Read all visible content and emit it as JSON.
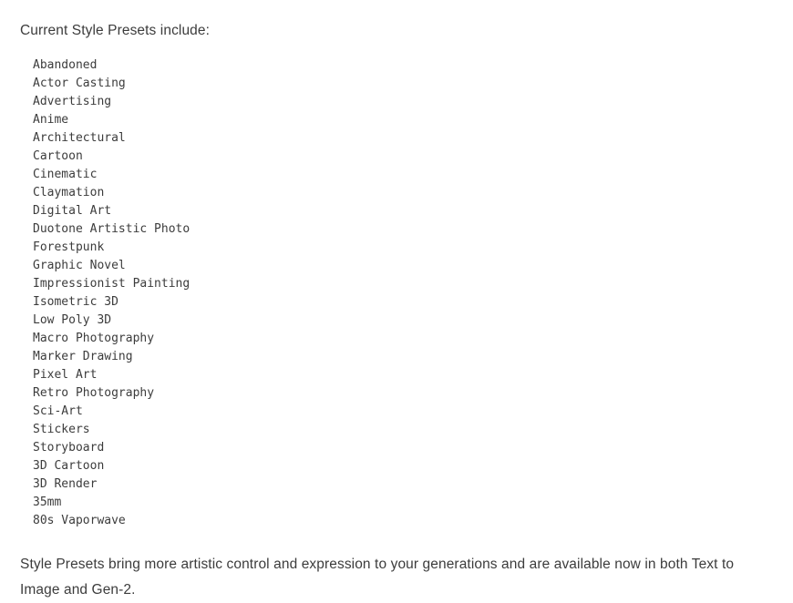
{
  "article": {
    "intro_text": "Current Style Presets include:",
    "presets": [
      "Abandoned",
      "Actor Casting",
      "Advertising",
      "Anime",
      "Architectural",
      "Cartoon",
      "Cinematic",
      "Claymation",
      "Digital Art",
      "Duotone Artistic Photo",
      "Forestpunk",
      "Graphic Novel",
      "Impressionist Painting",
      "Isometric 3D",
      "Low Poly 3D",
      "Macro Photography",
      "Marker Drawing",
      "Pixel Art",
      "Retro Photography",
      "Sci-Art",
      "Stickers",
      "Storyboard",
      "3D Cartoon",
      "3D Render",
      "35mm",
      "80s Vaporwave"
    ],
    "outro_text": "Style Presets bring more artistic control and expression to your generations and are available now in both Text to Image and Gen-2."
  },
  "colors": {
    "text": "#3c3c3c",
    "background": "#ffffff"
  }
}
